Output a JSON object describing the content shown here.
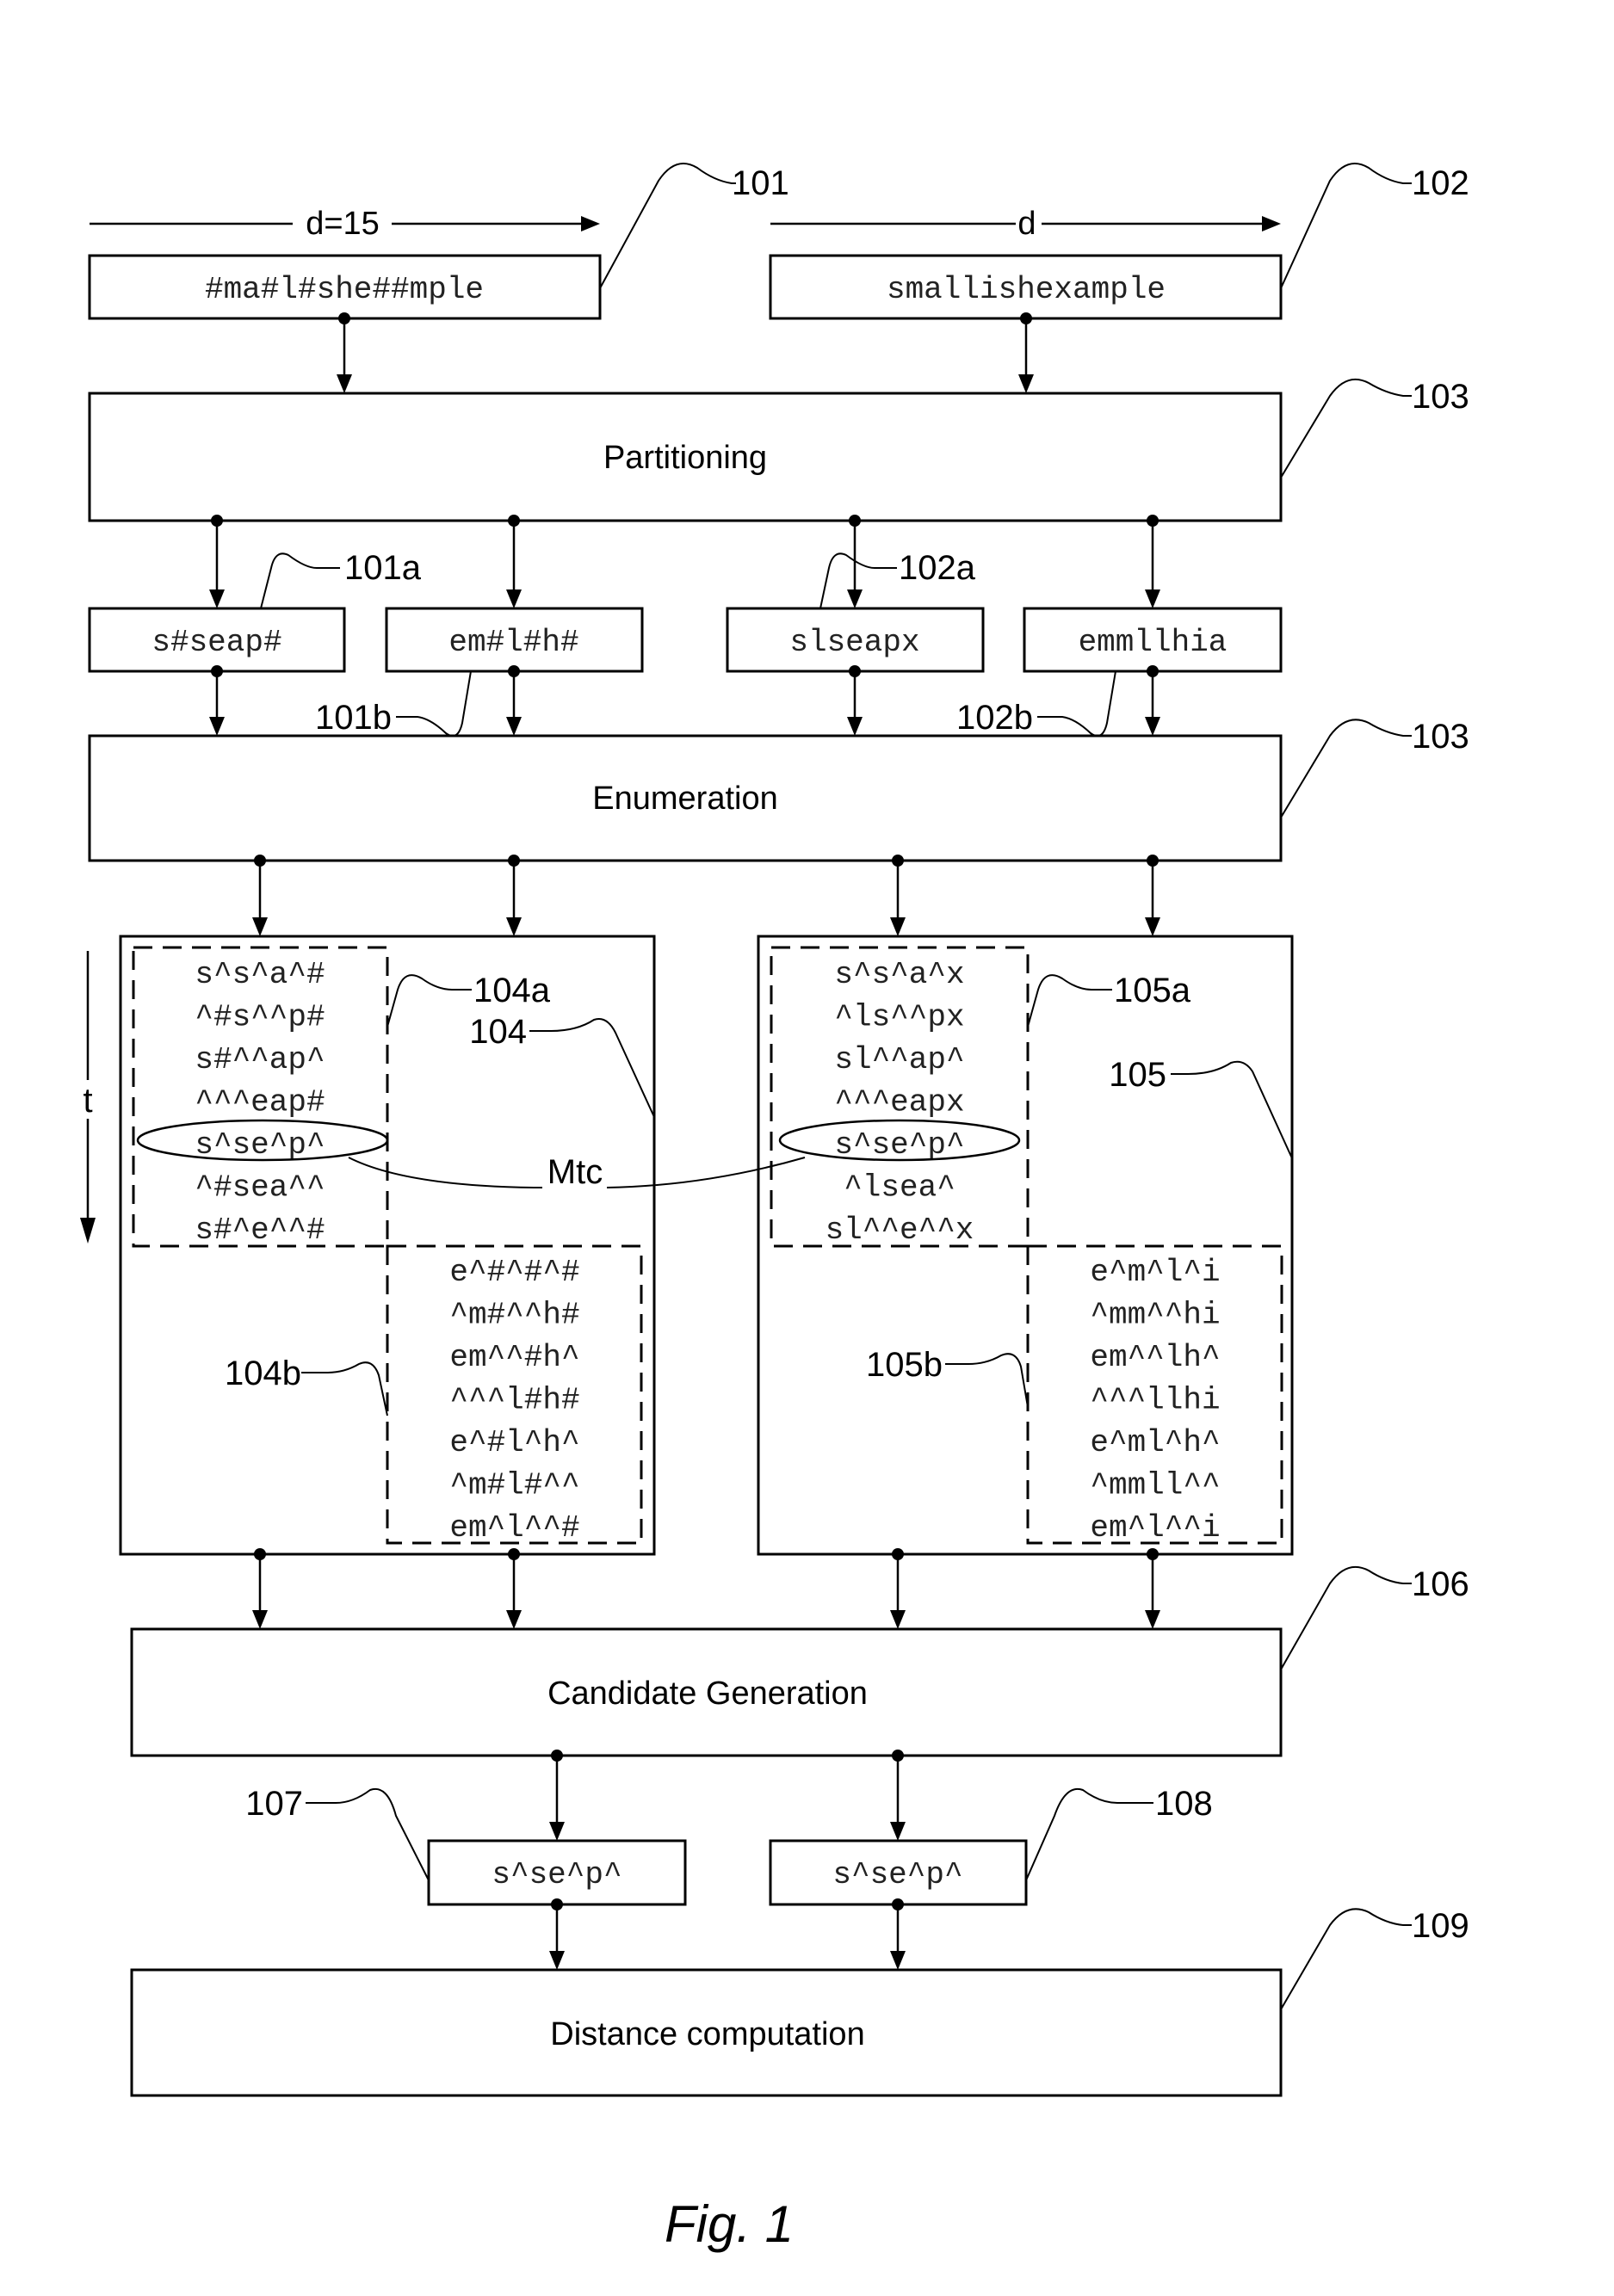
{
  "figure": {
    "caption": "Fig. 1"
  },
  "inputs": {
    "left": {
      "ref": "101",
      "length_label": "d=15",
      "string": "#ma#l#she##mple"
    },
    "right": {
      "ref": "102",
      "length_label": "d",
      "string": "smallishexample"
    }
  },
  "steps": {
    "partitioning": {
      "ref": "103",
      "label": "Partitioning"
    },
    "enumeration": {
      "ref": "103",
      "label": "Enumeration"
    },
    "candidate_generation": {
      "ref": "106",
      "label": "Candidate Generation"
    },
    "distance_computation": {
      "ref": "109",
      "label": "Distance computation"
    }
  },
  "partitions": [
    {
      "ref": "101a",
      "text": "s#seap#"
    },
    {
      "ref": "101b",
      "text": "em#l#h#"
    },
    {
      "ref": "102a",
      "text": "slseapx"
    },
    {
      "ref": "102b",
      "text": "emmllhia"
    }
  ],
  "enumerations": {
    "left": {
      "ref": "104",
      "a": {
        "ref": "104a",
        "items": [
          "s^s^a^#",
          "^#s^^p#",
          "s#^^ap^",
          "^^^eap#",
          "s^se^p^",
          "^#sea^^",
          "s#^e^^#"
        ]
      },
      "b": {
        "ref": "104b",
        "items": [
          "e^#^#^#",
          "^m#^^h#",
          "em^^#h^",
          "^^^l#h#",
          "e^#l^h^",
          "^m#l#^^",
          "em^l^^#"
        ]
      }
    },
    "right": {
      "ref": "105",
      "a": {
        "ref": "105a",
        "items": [
          "s^s^a^x",
          "^ls^^px",
          "sl^^ap^",
          "^^^eapx",
          "s^se^p^",
          "^lsea^",
          "sl^^e^^x"
        ]
      },
      "b": {
        "ref": "105b",
        "items": [
          "e^m^l^i",
          "^mm^^hi",
          "em^^lh^",
          "^^^llhi",
          "e^ml^h^",
          "^mmll^^",
          "em^l^^i"
        ]
      }
    },
    "time_axis_label": "t",
    "match_label": "Mtc",
    "matched_index": 4
  },
  "candidates": [
    {
      "ref": "107",
      "text": "s^se^p^"
    },
    {
      "ref": "108",
      "text": "s^se^p^"
    }
  ]
}
